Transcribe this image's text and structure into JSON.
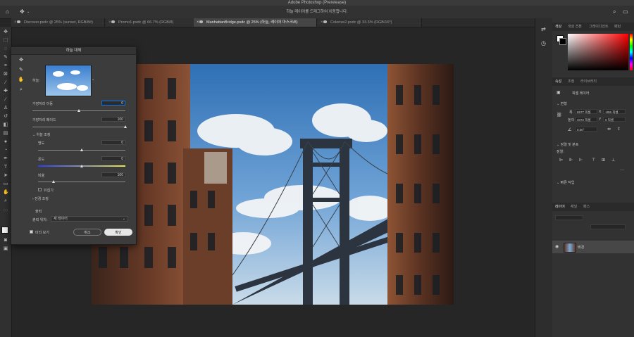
{
  "app": {
    "title": "Adobe Photoshop (Prerelease)"
  },
  "options_bar": {
    "hint": "하늘 레이어를 드래그하여 이동합니다."
  },
  "tabs": [
    {
      "label": "Discover.psdc @ 25% (sunset, RGB/8#)",
      "active": false
    },
    {
      "label": "Promo1.psdc @ 66.7% (RGB/8)",
      "active": false
    },
    {
      "label": "ManhattanBridge.psdc @ 25% (하늘, 레이어 마스크/8)",
      "active": true
    },
    {
      "label": "Colorize2.psdc @ 33.3% (RGB/16*)",
      "active": false
    }
  ],
  "dialog": {
    "title": "하늘 대체",
    "sky_label": "하늘:",
    "edge_shift_label": "가장자리 이동",
    "edge_shift_value": "0",
    "edge_shift_level": 0.5,
    "fade_edge_label": "가장자리 페이드",
    "fade_edge_value": "100",
    "fade_edge_level": 1.0,
    "sky_adjust_label": "하늘 조정",
    "brightness_label": "명도",
    "brightness_value": "0",
    "brightness_level": 0.5,
    "temperature_label": "온도",
    "temperature_value": "0",
    "temperature_level": 0.5,
    "scale_label": "비율",
    "scale_value": "100",
    "scale_level": 0.18,
    "flip_label": "뒤집기",
    "foreground_label": "전경 조정",
    "output_label": "출력",
    "output_to_label": "출력 위치:",
    "output_to_value": "새 레이어",
    "preview_label": "미리 보기",
    "cancel_label": "취소",
    "ok_label": "확인"
  },
  "right_panel": {
    "top_tabs": [
      "색상",
      "색상 견본",
      "그레이디언트",
      "패턴"
    ],
    "mid_tabs": [
      "속성",
      "조정",
      "라이브러리"
    ],
    "pixel_layer_label": "픽셀 레이어",
    "transform_title": "변형",
    "w_label": "폭",
    "w_value": "6577 픽셀",
    "x_label": "X",
    "x_value": "-956 픽셀",
    "h_label": "높이",
    "h_value": "4072 픽셀",
    "y_label": "Y",
    "y_value": "0 픽셀",
    "angle_value": "0.00°",
    "align_title": "정렬 및 분포",
    "align_label": "정렬:",
    "quick_actions_title": "빠른 작업",
    "layer_tabs": [
      "레이어",
      "채널",
      "패스"
    ],
    "layer_name": "배경"
  },
  "colors": {
    "accent": "#1473e6",
    "picker_red": "#ff0000"
  }
}
